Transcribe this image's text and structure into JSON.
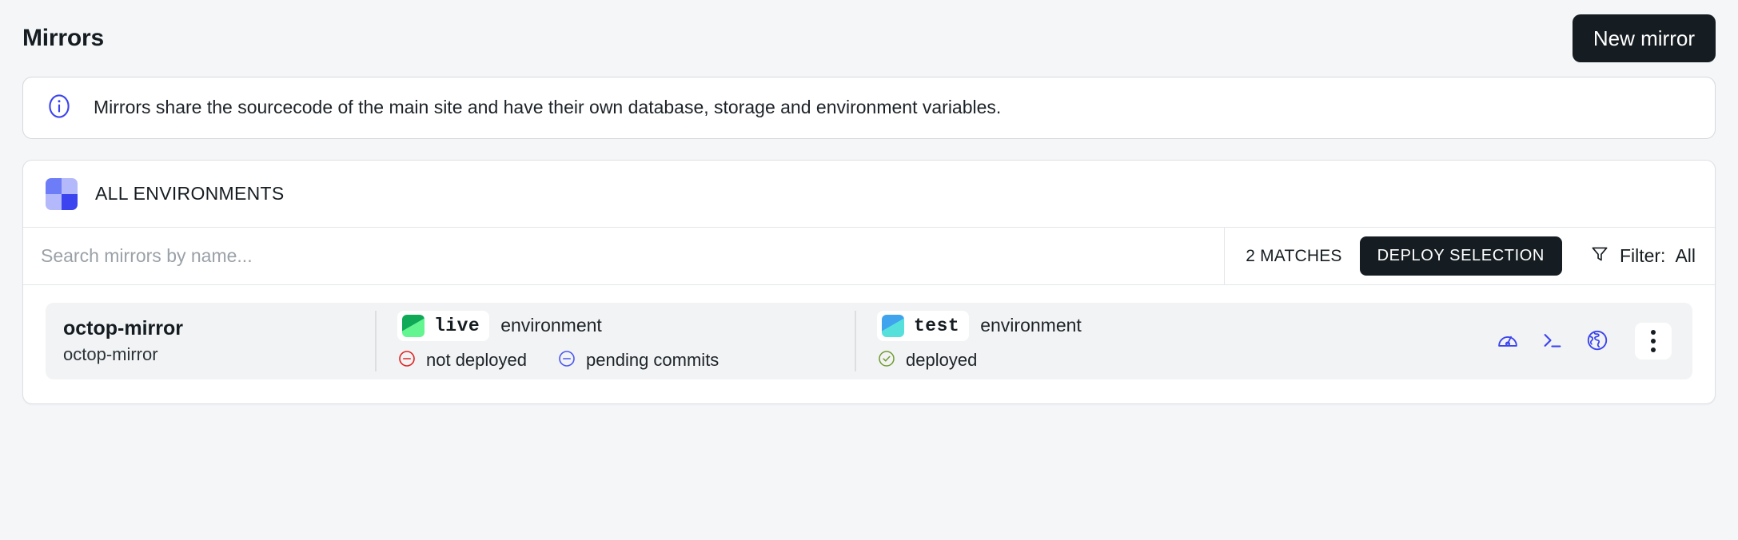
{
  "header": {
    "title": "Mirrors",
    "new_mirror_label": "New mirror"
  },
  "info_banner": {
    "icon": "info-circle-icon",
    "text": "Mirrors share the sourcecode of the main site and have their own database, storage and environment variables."
  },
  "environments_section": {
    "icon": "grid-squares-icon",
    "title": "ALL ENVIRONMENTS",
    "icon_colors": {
      "top_left": "#6d7cf7",
      "top_right": "#b3b9fb",
      "bottom_left": "#b3b9fb",
      "bottom_right": "#3b44ef"
    }
  },
  "toolbar": {
    "search_placeholder": "Search mirrors by name...",
    "search_value": "",
    "matches_label": "2 MATCHES",
    "deploy_label": "DEPLOY SELECTION",
    "filter_icon": "funnel-icon",
    "filter_label": "Filter:",
    "filter_value": "All"
  },
  "mirrors": [
    {
      "name": "octop-mirror",
      "subtitle": "octop-mirror",
      "environments": [
        {
          "key": "live",
          "chip_label": "live",
          "suffix": "environment",
          "statuses": [
            {
              "icon": "circle-minus-icon",
              "color": "#e02424",
              "label": "not deployed"
            },
            {
              "icon": "circle-minus-icon",
              "color": "#4b57f0",
              "label": "pending commits"
            }
          ]
        },
        {
          "key": "test",
          "chip_label": "test",
          "suffix": "environment",
          "statuses": [
            {
              "icon": "circle-check-icon",
              "color": "#6f9b2f",
              "label": "deployed"
            }
          ]
        }
      ],
      "actions": [
        {
          "icon": "gauge-icon",
          "color": "#3b44ef"
        },
        {
          "icon": "terminal-icon",
          "color": "#3b44ef"
        },
        {
          "icon": "globe-icon",
          "color": "#3b44ef"
        },
        {
          "icon": "kebab-menu-icon",
          "color": "#161d22"
        }
      ]
    }
  ],
  "colors": {
    "page_background": "#f4f6f8",
    "card_background": "#ffffff",
    "row_background": "#f2f3f4",
    "dark_button": "#161d22",
    "accent_blue": "#3b44ef"
  }
}
